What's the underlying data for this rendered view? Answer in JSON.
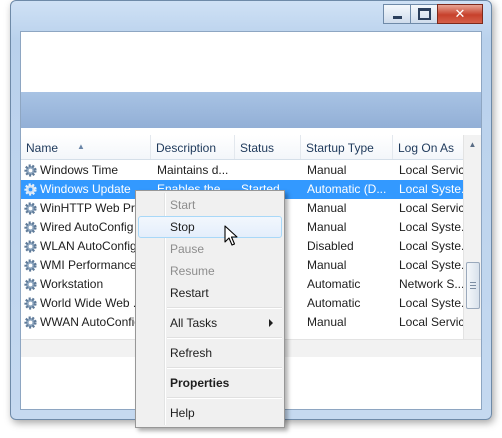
{
  "columns": {
    "name": "Name",
    "description": "Description",
    "status": "Status",
    "startup_type": "Startup Type",
    "log_on_as": "Log On As"
  },
  "rows": [
    {
      "name": "Windows Time",
      "description": "Maintains d...",
      "status": "",
      "startup": "Manual",
      "logon": "Local Service"
    },
    {
      "name": "Windows Update",
      "description": "Enables the ...",
      "status": "Started",
      "startup": "Automatic (D...",
      "logon": "Local Syste..."
    },
    {
      "name": "WinHTTP Web Pr...",
      "description": "",
      "status": "",
      "startup": "Manual",
      "logon": "Local Service"
    },
    {
      "name": "Wired AutoConfig",
      "description": "",
      "status": "",
      "startup": "Manual",
      "logon": "Local Syste..."
    },
    {
      "name": "WLAN AutoConfig",
      "description": "",
      "status": "",
      "startup": "Disabled",
      "logon": "Local Syste..."
    },
    {
      "name": "WMI Performance",
      "description": "",
      "status": "",
      "startup": "Manual",
      "logon": "Local Syste..."
    },
    {
      "name": "Workstation",
      "description": "",
      "status": "",
      "startup": "Automatic",
      "logon": "Network S..."
    },
    {
      "name": "World Wide Web ...",
      "description": "",
      "status": "",
      "startup": "Automatic",
      "logon": "Local Syste..."
    },
    {
      "name": "WWAN AutoConfig",
      "description": "",
      "status": "",
      "startup": "Manual",
      "logon": "Local Service"
    }
  ],
  "selected_row": "Windows Update",
  "context_menu": {
    "start": "Start",
    "stop": "Stop",
    "pause": "Pause",
    "resume": "Resume",
    "restart": "Restart",
    "all_tasks": "All Tasks",
    "refresh": "Refresh",
    "properties": "Properties",
    "help": "Help"
  },
  "icons": {
    "service": "gear-icon",
    "minimize": "minimize-icon",
    "maximize": "maximize-icon",
    "close": "close-icon",
    "sort": "sort-ascending-icon",
    "submenu": "submenu-arrow-icon",
    "cursor": "mouse-pointer-icon"
  },
  "colors": {
    "selection": "#3399ff",
    "hover_border": "#a8d8f8",
    "close_button": "#c7412c",
    "disabled_text": "#8d8d8d"
  }
}
